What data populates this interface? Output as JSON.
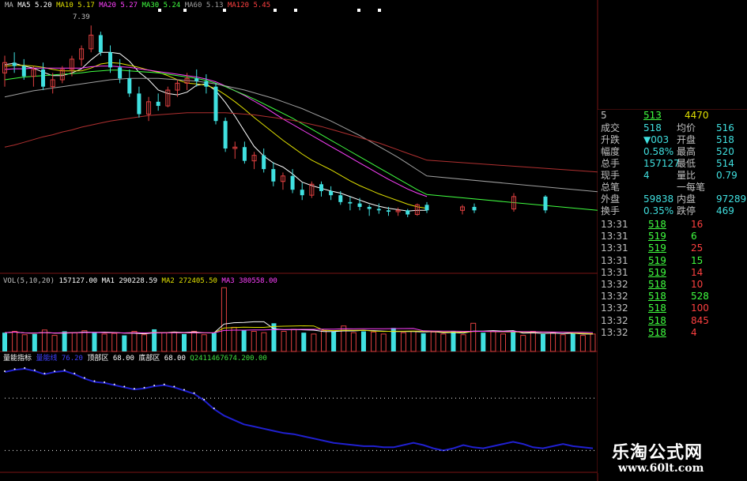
{
  "colors": {
    "up": "#e04040",
    "down": "#40e0e0",
    "ma5": "#ffffff",
    "ma10": "#e0e000",
    "ma20": "#ff40ff",
    "ma30": "#40ff40",
    "ma60": "#a0a0a0",
    "ma120": "#b03030",
    "blue": "#2020d0",
    "grid": "#7a1414"
  },
  "main_legend": {
    "prefix": "MA",
    "items": [
      {
        "label": "MA5",
        "value": "5.20",
        "color": "#ffffff"
      },
      {
        "label": "MA10",
        "value": "5.17",
        "color": "#e0e000"
      },
      {
        "label": "MA20",
        "value": "5.27",
        "color": "#ff40ff"
      },
      {
        "label": "MA30",
        "value": "5.24",
        "color": "#40ff40"
      },
      {
        "label": "MA60",
        "value": "5.13",
        "color": "#a0a0a0"
      },
      {
        "label": "MA120",
        "value": "5.45",
        "color": "#ff4040"
      }
    ],
    "high_mark": "7.39"
  },
  "vol_legend": {
    "title": "VOL(5,10,20)",
    "vol": "157127.00",
    "ma1": "MA1 290228.59",
    "ma2": "MA2 272405.50",
    "ma3": "MA3 380558.00"
  },
  "ind_legend": {
    "name": "量能指标",
    "line": "量能线",
    "val": "76.20",
    "top": "顶部区",
    "top_val": "68.00",
    "bottom": "底部区",
    "bottom_val": "68.00",
    "extra": "Q2411467674.200.00"
  },
  "side": {
    "header": {
      "label": "5",
      "buy": "513",
      "vol": "4470"
    },
    "stats": [
      {
        "l": "成交",
        "v": "518",
        "l2": "均价",
        "v2": "516"
      },
      {
        "l": "升跌",
        "v": "▼003",
        "l2": "开盘",
        "v2": "518"
      },
      {
        "l": "幅度",
        "v": "0.58%",
        "l2": "最高",
        "v2": "520"
      },
      {
        "l": "总手",
        "v": "157127",
        "l2": "最低",
        "v2": "514"
      },
      {
        "l": "现手",
        "v": "4",
        "l2": "量比",
        "v2": "0.79"
      },
      {
        "l": "总笔",
        "v": "",
        "l2": "一每笔",
        "v2": ""
      },
      {
        "l": "外盘",
        "v": "59838",
        "l2": "内盘",
        "v2": "97289"
      },
      {
        "l": "换手",
        "v": "0.35%",
        "l2": "跌停",
        "v2": "469"
      }
    ],
    "ticks": [
      {
        "t": "13:31",
        "p": "518",
        "v": "16"
      },
      {
        "t": "13:31",
        "p": "519",
        "v": "6"
      },
      {
        "t": "13:31",
        "p": "519",
        "v": "25"
      },
      {
        "t": "13:31",
        "p": "519",
        "v": "15"
      },
      {
        "t": "13:31",
        "p": "519",
        "v": "14"
      },
      {
        "t": "13:32",
        "p": "518",
        "v": "10"
      },
      {
        "t": "13:32",
        "p": "518",
        "v": "528"
      },
      {
        "t": "13:32",
        "p": "518",
        "v": "100"
      },
      {
        "t": "13:32",
        "p": "518",
        "v": "845"
      },
      {
        "t": "13:32",
        "p": "518",
        "v": "4"
      }
    ]
  },
  "watermark": {
    "line1": "乐淘公式网",
    "line2": "www.60lt.com"
  },
  "chart_data": [
    {
      "type": "candlestick",
      "title": "",
      "ylim": [
        4.6,
        7.6
      ],
      "ohlc": [
        [
          6.7,
          6.95,
          6.5,
          6.85
        ],
        [
          6.85,
          7.0,
          6.7,
          6.8
        ],
        [
          6.8,
          6.9,
          6.6,
          6.65
        ],
        [
          6.65,
          6.8,
          6.5,
          6.75
        ],
        [
          6.75,
          6.85,
          6.45,
          6.5
        ],
        [
          6.5,
          6.7,
          6.4,
          6.6
        ],
        [
          6.6,
          6.8,
          6.55,
          6.75
        ],
        [
          6.75,
          6.95,
          6.65,
          6.9
        ],
        [
          6.9,
          7.1,
          6.8,
          7.05
        ],
        [
          7.05,
          7.39,
          7.0,
          7.25
        ],
        [
          7.25,
          7.3,
          6.95,
          7.0
        ],
        [
          7.0,
          7.1,
          6.7,
          6.78
        ],
        [
          6.78,
          6.9,
          6.55,
          6.62
        ],
        [
          6.62,
          6.75,
          6.35,
          6.4
        ],
        [
          6.4,
          6.5,
          6.05,
          6.1
        ],
        [
          6.1,
          6.35,
          6.0,
          6.28
        ],
        [
          6.28,
          6.4,
          6.15,
          6.22
        ],
        [
          6.22,
          6.5,
          6.2,
          6.45
        ],
        [
          6.45,
          6.6,
          6.35,
          6.55
        ],
        [
          6.55,
          6.7,
          6.45,
          6.62
        ],
        [
          6.62,
          6.75,
          6.5,
          6.58
        ],
        [
          6.58,
          6.68,
          6.4,
          6.5
        ],
        [
          6.5,
          6.55,
          5.95,
          6.0
        ],
        [
          6.0,
          6.05,
          5.55,
          5.6
        ],
        [
          5.6,
          5.7,
          5.45,
          5.62
        ],
        [
          5.62,
          5.7,
          5.38,
          5.42
        ],
        [
          5.42,
          5.55,
          5.3,
          5.5
        ],
        [
          5.5,
          5.6,
          5.25,
          5.3
        ],
        [
          5.3,
          5.4,
          5.05,
          5.12
        ],
        [
          5.12,
          5.25,
          5.0,
          5.2
        ],
        [
          5.2,
          5.3,
          4.95,
          5.0
        ],
        [
          5.0,
          5.1,
          4.85,
          4.92
        ],
        [
          4.92,
          5.12,
          4.88,
          5.08
        ],
        [
          5.08,
          5.12,
          4.9,
          4.98
        ],
        [
          4.98,
          5.05,
          4.85,
          4.92
        ],
        [
          4.92,
          4.98,
          4.78,
          4.82
        ],
        [
          4.82,
          4.9,
          4.7,
          4.8
        ],
        [
          4.8,
          4.88,
          4.7,
          4.75
        ],
        [
          4.75,
          4.78,
          4.62,
          4.72
        ],
        [
          4.72,
          4.8,
          4.65,
          4.7
        ],
        [
          4.7,
          4.75,
          4.62,
          4.68
        ],
        [
          4.68,
          4.74,
          4.62,
          4.7
        ],
        [
          4.7,
          4.72,
          4.6,
          4.64
        ],
        [
          4.64,
          4.8,
          4.62,
          4.78
        ],
        [
          4.78,
          4.82,
          4.66,
          4.7
        ]
      ],
      "ma": [
        {
          "name": "MA5",
          "values": [
            6.82,
            6.84,
            6.8,
            6.77,
            6.71,
            6.66,
            6.66,
            6.7,
            6.76,
            6.89,
            7.0,
            7.0,
            6.98,
            6.87,
            6.71,
            6.6,
            6.45,
            6.4,
            6.38,
            6.42,
            6.52,
            6.54,
            6.44,
            6.27,
            6.07,
            5.85,
            5.63,
            5.49,
            5.39,
            5.33,
            5.23,
            5.11,
            5.06,
            5.02,
            4.98,
            4.95,
            4.9,
            4.85,
            4.8,
            4.76,
            4.73,
            4.71,
            4.69,
            4.7,
            4.7
          ]
        },
        {
          "name": "MA10",
          "values": [
            6.8,
            6.81,
            6.81,
            6.8,
            6.78,
            6.75,
            6.73,
            6.73,
            6.73,
            6.77,
            6.83,
            6.85,
            6.84,
            6.81,
            6.78,
            6.74,
            6.71,
            6.66,
            6.6,
            6.55,
            6.54,
            6.52,
            6.47,
            6.38,
            6.28,
            6.17,
            6.05,
            5.94,
            5.83,
            5.72,
            5.62,
            5.52,
            5.43,
            5.36,
            5.29,
            5.21,
            5.13,
            5.06,
            5.0,
            4.94,
            4.89,
            4.84,
            4.79,
            4.75,
            4.73
          ]
        },
        {
          "name": "MA20",
          "values": [
            6.75,
            6.76,
            6.76,
            6.77,
            6.77,
            6.77,
            6.77,
            6.77,
            6.77,
            6.79,
            6.8,
            6.8,
            6.79,
            6.78,
            6.76,
            6.74,
            6.72,
            6.7,
            6.68,
            6.66,
            6.64,
            6.61,
            6.57,
            6.51,
            6.44,
            6.37,
            6.29,
            6.21,
            6.12,
            6.03,
            5.95,
            5.87,
            5.79,
            5.71,
            5.63,
            5.55,
            5.47,
            5.39,
            5.31,
            5.23,
            5.15,
            5.08,
            5.01,
            4.95,
            4.9
          ]
        },
        {
          "name": "MA30",
          "values": [
            6.6,
            6.62,
            6.64,
            6.65,
            6.66,
            6.67,
            6.68,
            6.69,
            6.7,
            6.72,
            6.73,
            6.74,
            6.74,
            6.73,
            6.72,
            6.71,
            6.7,
            6.68,
            6.66,
            6.64,
            6.62,
            6.59,
            6.55,
            6.5,
            6.44,
            6.38,
            6.32,
            6.25,
            6.18,
            6.11,
            6.04,
            5.96,
            5.88,
            5.8,
            5.72,
            5.64,
            5.56,
            5.48,
            5.4,
            5.32,
            5.24,
            5.16,
            5.08,
            5.0,
            4.93
          ]
        },
        {
          "name": "MA60",
          "values": [
            6.35,
            6.38,
            6.41,
            6.44,
            6.46,
            6.48,
            6.5,
            6.52,
            6.54,
            6.56,
            6.58,
            6.6,
            6.61,
            6.62,
            6.62,
            6.62,
            6.62,
            6.61,
            6.6,
            6.59,
            6.58,
            6.56,
            6.54,
            6.51,
            6.48,
            6.45,
            6.41,
            6.37,
            6.33,
            6.28,
            6.23,
            6.18,
            6.12,
            6.06,
            6.0,
            5.93,
            5.86,
            5.79,
            5.71,
            5.63,
            5.55,
            5.47,
            5.38,
            5.29,
            5.2
          ]
        },
        {
          "name": "MA120",
          "values": [
            5.62,
            5.65,
            5.69,
            5.73,
            5.77,
            5.8,
            5.84,
            5.87,
            5.91,
            5.94,
            5.97,
            6.0,
            6.02,
            6.04,
            6.06,
            6.08,
            6.09,
            6.1,
            6.11,
            6.12,
            6.12,
            6.12,
            6.12,
            6.12,
            6.11,
            6.1,
            6.09,
            6.07,
            6.05,
            6.03,
            6.01,
            5.98,
            5.95,
            5.92,
            5.88,
            5.84,
            5.8,
            5.76,
            5.72,
            5.68,
            5.63,
            5.58,
            5.53,
            5.48,
            5.43
          ]
        }
      ]
    },
    {
      "type": "bar",
      "title": "VOL",
      "ylim": [
        0,
        1000000
      ],
      "values": [
        280000,
        300000,
        250000,
        260000,
        320000,
        240000,
        300000,
        280000,
        310000,
        290000,
        260000,
        270000,
        240000,
        300000,
        250000,
        330000,
        280000,
        290000,
        260000,
        300000,
        250000,
        280000,
        950000,
        360000,
        320000,
        300000,
        280000,
        420000,
        300000,
        330000,
        280000,
        260000,
        310000,
        300000,
        380000,
        280000,
        300000,
        290000,
        260000,
        350000,
        280000,
        300000,
        270000,
        290000,
        260000,
        300000,
        250000,
        420000,
        280000,
        300000,
        260000,
        290000,
        240000,
        300000,
        260000,
        280000,
        250000,
        270000,
        240000,
        260000
      ]
    },
    {
      "type": "line",
      "title": "量能指标",
      "ylim": [
        0,
        100
      ],
      "series": [
        {
          "name": "量能线",
          "values": [
            92,
            94,
            95,
            93,
            90,
            92,
            93,
            90,
            86,
            83,
            82,
            80,
            78,
            76,
            77,
            79,
            80,
            78,
            75,
            72,
            66,
            58,
            52,
            48,
            44,
            42,
            40,
            38,
            36,
            35,
            33,
            31,
            29,
            27,
            26,
            25,
            24,
            24,
            23,
            23,
            25,
            27,
            25,
            22,
            20,
            22,
            25,
            23,
            22,
            24,
            26,
            28,
            26,
            23,
            22,
            24,
            26,
            24,
            23,
            22
          ]
        },
        {
          "name": "顶部区",
          "values": [
            68,
            68
          ]
        },
        {
          "name": "底部区",
          "values": [
            20,
            20
          ]
        }
      ]
    }
  ]
}
